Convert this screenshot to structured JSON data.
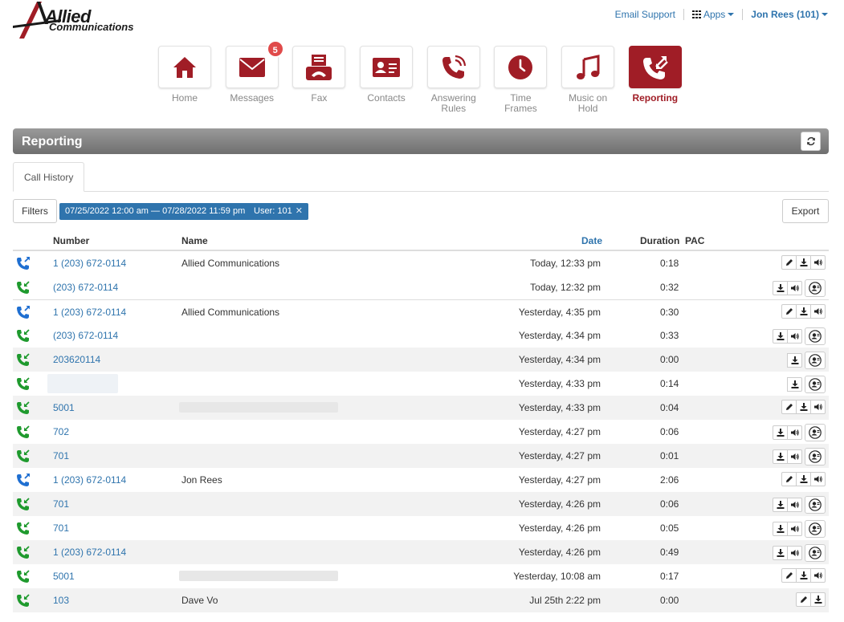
{
  "brand": {
    "name": "Allied",
    "sub": "Communications"
  },
  "top_links": {
    "support": "Email Support",
    "apps": "Apps",
    "user": "Jon Rees (101)"
  },
  "nav": {
    "tiles": [
      {
        "label": "Home",
        "icon": "home-icon",
        "badge": null,
        "active": false
      },
      {
        "label": "Messages",
        "icon": "envelope-icon",
        "badge": "5",
        "active": false
      },
      {
        "label": "Fax",
        "icon": "fax-icon",
        "badge": null,
        "active": false
      },
      {
        "label": "Contacts",
        "icon": "contact-card-icon",
        "badge": null,
        "active": false
      },
      {
        "label": "Answering Rules",
        "icon": "phone-waves-icon",
        "badge": null,
        "active": false
      },
      {
        "label": "Time Frames",
        "icon": "clock-icon",
        "badge": null,
        "active": false
      },
      {
        "label": "Music on Hold",
        "icon": "music-note-icon",
        "badge": null,
        "active": false
      },
      {
        "label": "Reporting",
        "icon": "phone-arrows-icon",
        "badge": null,
        "active": true
      }
    ]
  },
  "section": {
    "title": "Reporting"
  },
  "tabs": [
    {
      "label": "Call History",
      "active": true
    }
  ],
  "filters": {
    "button": "Filters",
    "chips": [
      {
        "label": "07/25/2022 12:00 am — 07/28/2022 11:59 pm",
        "closable": false
      },
      {
        "label": "User: 101",
        "closable": true
      }
    ],
    "export": "Export"
  },
  "table": {
    "headers": {
      "number": "Number",
      "name": "Name",
      "date": "Date",
      "duration": "Duration",
      "pac": "PAC"
    },
    "rows": [
      {
        "dir": "outbound",
        "number": "1 (203) 672-0114",
        "name": "Allied Communications",
        "date": "Today, 12:33 pm",
        "duration": "0:18",
        "actions": [
          "edit",
          "download",
          "audio"
        ],
        "big": false,
        "alt": false,
        "line": false
      },
      {
        "dir": "inbound",
        "number": "(203) 672-0114",
        "name": "",
        "date": "Today, 12:32 pm",
        "duration": "0:32",
        "actions": [
          "download",
          "audio"
        ],
        "big": true,
        "alt": false,
        "line": false
      },
      {
        "dir": "outbound",
        "number": "1 (203) 672-0114",
        "name": "Allied Communications",
        "date": "Yesterday, 4:35 pm",
        "duration": "0:30",
        "actions": [
          "edit",
          "download",
          "audio"
        ],
        "big": false,
        "alt": false,
        "line": true
      },
      {
        "dir": "inbound",
        "number": "(203) 672-0114",
        "name": "",
        "date": "Yesterday, 4:34 pm",
        "duration": "0:33",
        "actions": [
          "download",
          "audio"
        ],
        "big": true,
        "alt": false,
        "line": false
      },
      {
        "dir": "inbound",
        "number": "203620114",
        "name": "",
        "date": "Yesterday, 4:34 pm",
        "duration": "0:00",
        "actions": [
          "download"
        ],
        "big": true,
        "alt": true,
        "line": false
      },
      {
        "dir": "inbound",
        "number": "",
        "name": "",
        "date": "Yesterday, 4:33 pm",
        "duration": "0:14",
        "actions": [
          "download"
        ],
        "big": true,
        "alt": false,
        "line": false,
        "redact_number": true
      },
      {
        "dir": "inbound",
        "number": "5001",
        "name": "",
        "date": "Yesterday, 4:33 pm",
        "duration": "0:04",
        "actions": [
          "edit",
          "download",
          "audio"
        ],
        "big": false,
        "alt": true,
        "line": false,
        "redact_name": true
      },
      {
        "dir": "inbound",
        "number": "702",
        "name": "",
        "date": "Yesterday, 4:27 pm",
        "duration": "0:06",
        "actions": [
          "download",
          "audio"
        ],
        "big": true,
        "alt": false,
        "line": false
      },
      {
        "dir": "inbound",
        "number": "701",
        "name": "",
        "date": "Yesterday, 4:27 pm",
        "duration": "0:01",
        "actions": [
          "download",
          "audio"
        ],
        "big": true,
        "alt": true,
        "line": false
      },
      {
        "dir": "outbound",
        "number": "1 (203) 672-0114",
        "name": "Jon Rees",
        "date": "Yesterday, 4:27 pm",
        "duration": "2:06",
        "actions": [
          "edit",
          "download",
          "audio"
        ],
        "big": false,
        "alt": false,
        "line": false
      },
      {
        "dir": "inbound",
        "number": "701",
        "name": "",
        "date": "Yesterday, 4:26 pm",
        "duration": "0:06",
        "actions": [
          "download",
          "audio"
        ],
        "big": true,
        "alt": true,
        "line": false
      },
      {
        "dir": "inbound",
        "number": "701",
        "name": "",
        "date": "Yesterday, 4:26 pm",
        "duration": "0:05",
        "actions": [
          "download",
          "audio"
        ],
        "big": true,
        "alt": false,
        "line": false
      },
      {
        "dir": "inbound",
        "number": "1 (203) 672-0114",
        "name": "",
        "date": "Yesterday, 4:26 pm",
        "duration": "0:49",
        "actions": [
          "download",
          "audio"
        ],
        "big": true,
        "alt": true,
        "line": false
      },
      {
        "dir": "inbound",
        "number": "5001",
        "name": "",
        "date": "Yesterday, 10:08 am",
        "duration": "0:17",
        "actions": [
          "edit",
          "download",
          "audio"
        ],
        "big": false,
        "alt": false,
        "line": false,
        "redact_name": true
      },
      {
        "dir": "inbound",
        "number": "103",
        "name": "Dave Vo",
        "date": "Jul 25th 2:22 pm",
        "duration": "0:00",
        "actions": [
          "edit",
          "download"
        ],
        "big": false,
        "alt": true,
        "line": false
      }
    ]
  },
  "colors": {
    "accent": "#a01d26",
    "link": "#2f74ad",
    "inbound": "#1f9a2e",
    "outbound": "#1f6fd1"
  }
}
